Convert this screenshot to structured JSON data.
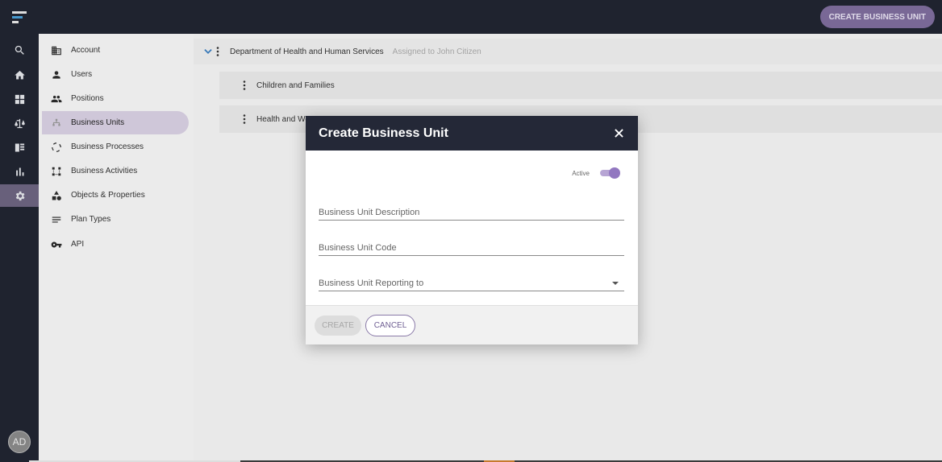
{
  "topbar": {
    "create_button": "CREATE BUSINESS UNIT"
  },
  "rail": {
    "logo": "menu-logo-icon",
    "items": [
      "search-icon",
      "home-icon",
      "dashboard-icon",
      "scales-icon",
      "list-icon",
      "bar-chart-icon",
      "gear-icon"
    ],
    "active_index": 6,
    "avatar_initials": "AD"
  },
  "menu": {
    "items": [
      {
        "label": "Account",
        "icon": "building-icon"
      },
      {
        "label": "Users",
        "icon": "person-icon"
      },
      {
        "label": "Positions",
        "icon": "people-icon"
      },
      {
        "label": "Business Units",
        "icon": "hierarchy-icon"
      },
      {
        "label": "Business Processes",
        "icon": "process-cycle-icon"
      },
      {
        "label": "Business Activities",
        "icon": "activities-icon"
      },
      {
        "label": "Objects & Properties",
        "icon": "shapes-icon"
      },
      {
        "label": "Plan Types",
        "icon": "lines-icon"
      },
      {
        "label": "API",
        "icon": "key-icon"
      }
    ],
    "active_index": 3
  },
  "tree": {
    "root": {
      "name": "Department of Health and Human Services",
      "assigned": "Assigned to John Citizen"
    },
    "children": [
      "Children and Families",
      "Health and We"
    ]
  },
  "modal": {
    "title": "Create Business Unit",
    "active_label": "Active",
    "active_on": true,
    "fields": {
      "description_placeholder": "Business Unit Description",
      "code_placeholder": "Business Unit Code",
      "reporting_placeholder": "Business Unit Reporting to"
    },
    "create_label": "CREATE",
    "cancel_label": "CANCEL"
  },
  "colors": {
    "accent": "#7e6d9d",
    "toggle": "#9277c0",
    "dark": "#212531"
  }
}
